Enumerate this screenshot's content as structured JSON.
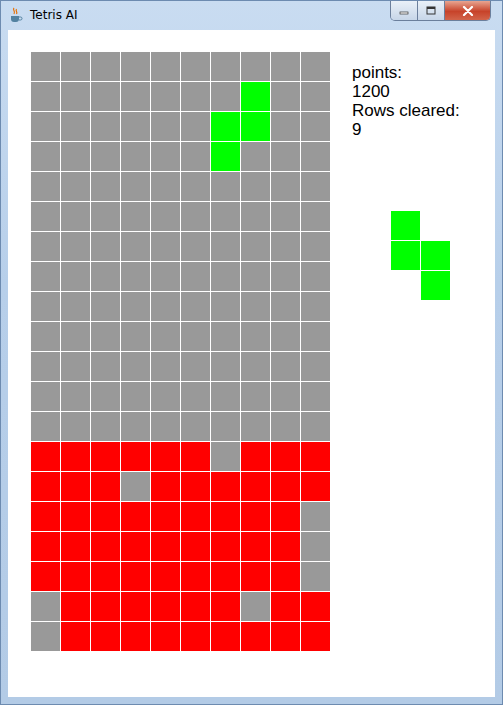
{
  "window": {
    "title": "Tetris AI"
  },
  "board": {
    "rows": [
      "..........",
      ".......A..",
      "......AA..",
      "......A...",
      "..........",
      "..........",
      "..........",
      "..........",
      "..........",
      "..........",
      "..........",
      "..........",
      "..........",
      "XXXXXX.XXX",
      "XXX.XXXXXX",
      "XXXXXXXXX.",
      "XXXXXXXXX.",
      "XXXXXXXXX.",
      ".XXXXXX.XX",
      ".XXXXXXXXX"
    ]
  },
  "stats": [
    {
      "label": "points:",
      "value": "1200"
    },
    {
      "label": "Rows cleared:",
      "value": "9"
    }
  ],
  "next_piece": {
    "rows": [
      "A.",
      "AA",
      ".A"
    ]
  }
}
